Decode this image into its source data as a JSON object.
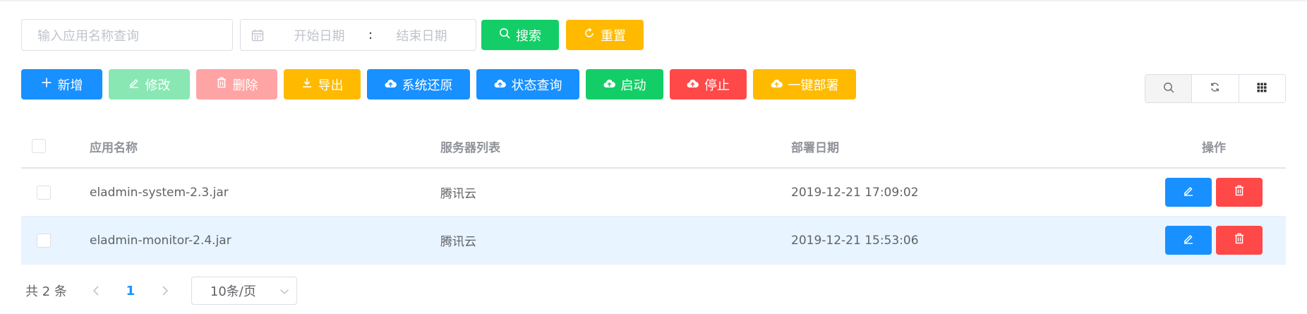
{
  "search": {
    "name_placeholder": "输入应用名称查询",
    "date_start_placeholder": "开始日期",
    "date_separator": ":",
    "date_end_placeholder": "结束日期",
    "search_label": "搜索",
    "reset_label": "重置"
  },
  "toolbar": {
    "add_label": "新增",
    "edit_label": "修改",
    "delete_label": "删除",
    "export_label": "导出",
    "restore_label": "系统还原",
    "status_label": "状态查询",
    "start_label": "启动",
    "stop_label": "停止",
    "deploy_label": "一键部署"
  },
  "right_tools": [
    "search-icon",
    "refresh-icon",
    "grid-icon"
  ],
  "table": {
    "headers": {
      "name": "应用名称",
      "servers": "服务器列表",
      "date": "部署日期",
      "ops": "操作"
    },
    "rows": [
      {
        "name": "eladmin-system-2.3.jar",
        "servers": "腾讯云",
        "date": "2019-12-21 17:09:02"
      },
      {
        "name": "eladmin-monitor-2.4.jar",
        "servers": "腾讯云",
        "date": "2019-12-21 15:53:06"
      }
    ]
  },
  "pagination": {
    "total": "共 2 条",
    "current_page": "1",
    "page_size": "10条/页"
  },
  "colors": {
    "primary": "#1890ff",
    "success": "#13ce66",
    "warning": "#ffba00",
    "danger": "#ff4949",
    "row_hover": "#e8f4ff"
  }
}
